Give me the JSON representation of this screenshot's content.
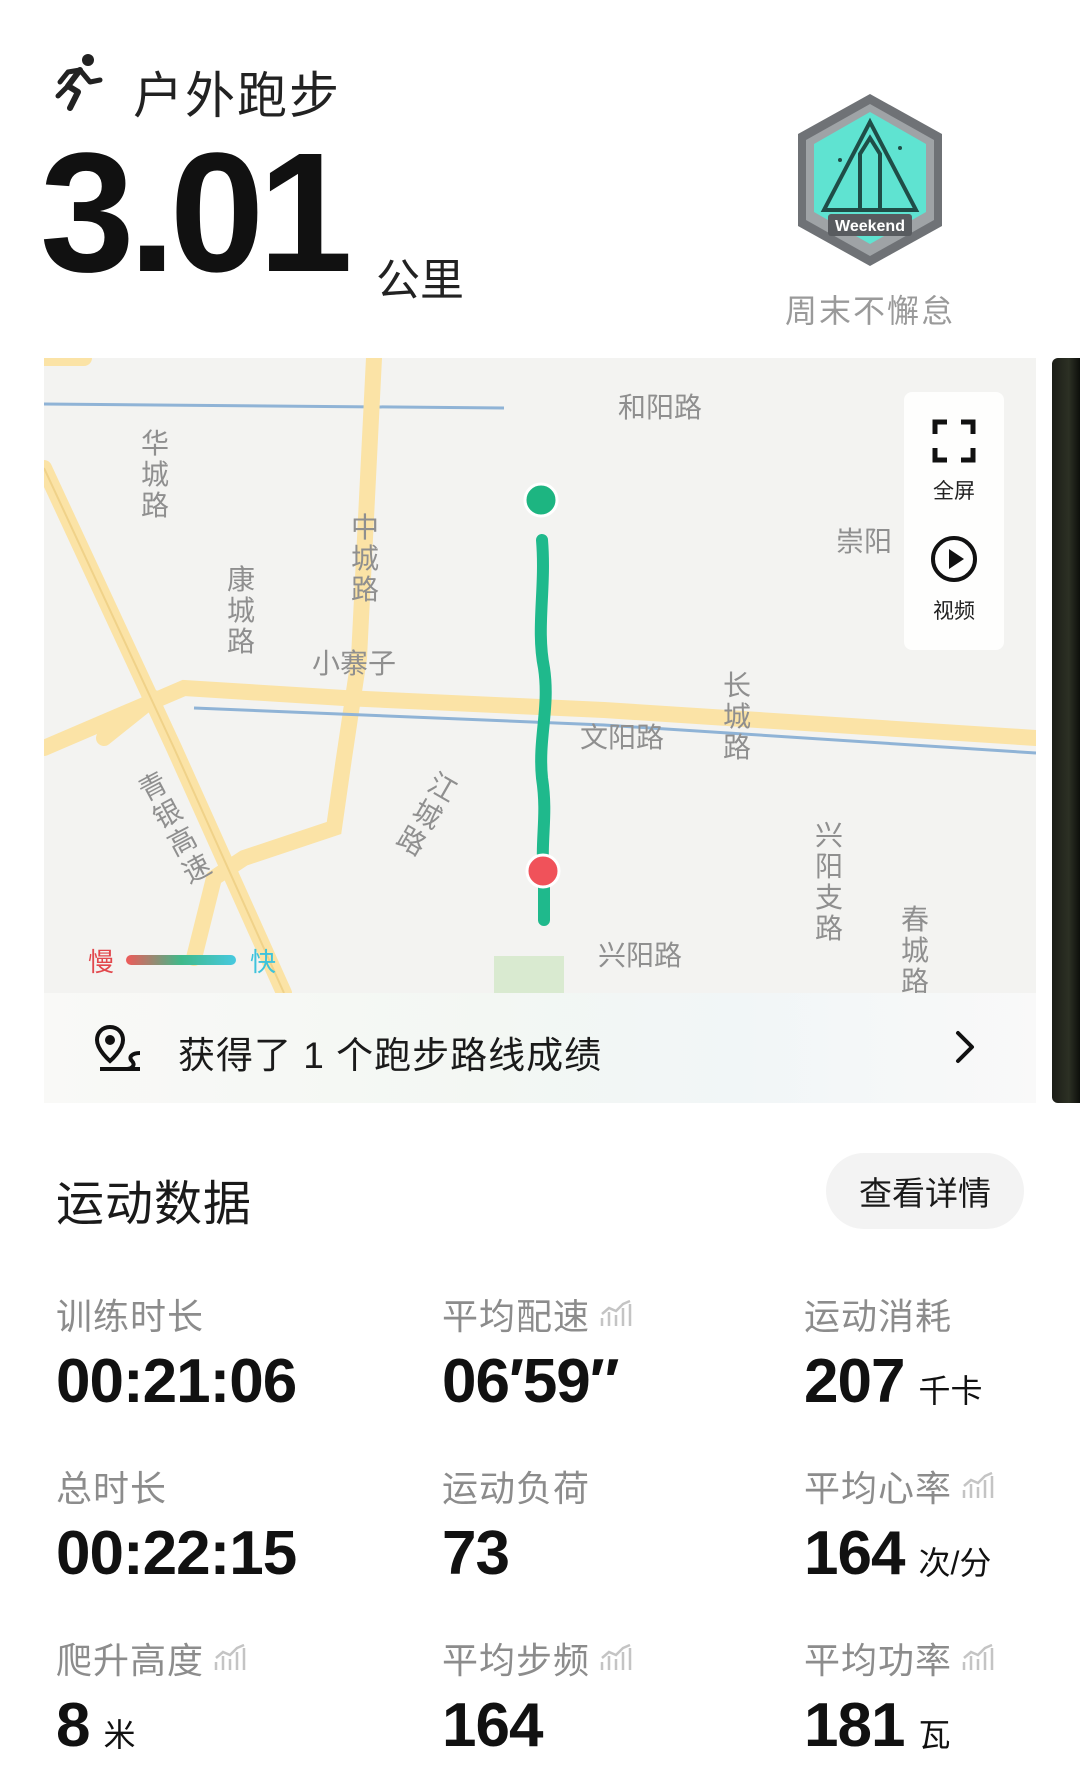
{
  "header": {
    "activity_icon": "running-person-icon",
    "activity_title": "户外跑步",
    "distance_value": "3.01",
    "distance_unit": "公里",
    "badge": {
      "emblem_text": "Weekend",
      "caption": "周末不懈怠",
      "colors": {
        "fill": "#5fe3d1",
        "frame": "#6f7276"
      }
    }
  },
  "map": {
    "labels": {
      "heyang_road": "和阳路",
      "hua_cheng_road": "华城路",
      "zhong_cheng_road": "中城路",
      "kang_cheng_road": "康城路",
      "xiao_zhaizi": "小寨子",
      "chongyang": "崇阳",
      "wenyang_road": "文阳路",
      "chang_cheng_road": "长城路",
      "jiang_cheng_road": "江城路",
      "qingyin_expressway": "青银高速",
      "xingyang_branch_road": "兴阳支路",
      "chun_cheng_road": "春城路",
      "xingyang_road": "兴阳路"
    },
    "controls": {
      "fullscreen_label": "全屏",
      "video_label": "视频"
    },
    "legend": {
      "slow": "慢",
      "fast": "快"
    },
    "colors": {
      "route": "#1fb98c",
      "start": "#1db581",
      "end": "#f0525a",
      "road": "#fbe3a6"
    }
  },
  "achievement": {
    "icon": "route-pin-icon",
    "text": "获得了 1 个跑步路线成绩"
  },
  "stats": {
    "title": "运动数据",
    "details_button": "查看详情",
    "items": [
      {
        "label": "训练时长",
        "value": "00:21:06",
        "unit": ""
      },
      {
        "label": "平均配速",
        "value": "06′59″",
        "unit": ""
      },
      {
        "label": "运动消耗",
        "value": "207",
        "unit": "千卡"
      },
      {
        "label": "总时长",
        "value": "00:22:15",
        "unit": ""
      },
      {
        "label": "运动负荷",
        "value": "73",
        "unit": ""
      },
      {
        "label": "平均心率",
        "value": "164",
        "unit": "次/分"
      },
      {
        "label": "爬升高度",
        "value": "8",
        "unit": "米"
      },
      {
        "label": "平均步频",
        "value": "164",
        "unit": ""
      },
      {
        "label": "平均功率",
        "value": "181",
        "unit": "瓦"
      }
    ]
  }
}
